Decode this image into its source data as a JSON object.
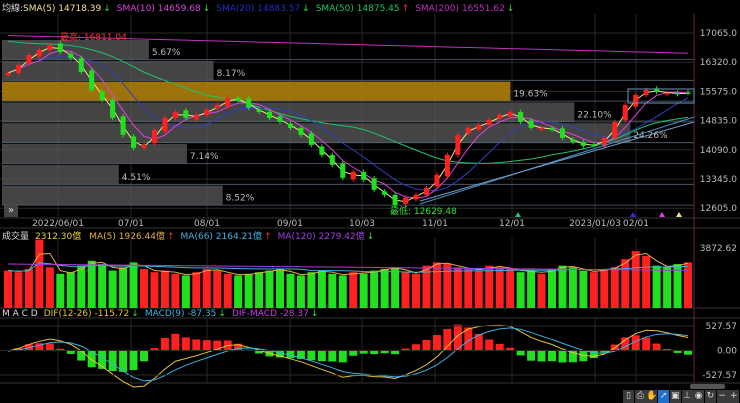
{
  "price_header": {
    "prefix": "均線:",
    "items": [
      {
        "label": "SMA(5) 14718.39",
        "arrow": "↓",
        "color": "#f0e68c"
      },
      {
        "label": "SMA(10) 14659.68",
        "arrow": "↓",
        "color": "#e040e0"
      },
      {
        "label": "SMA(20) 14883.57",
        "arrow": "↓",
        "color": "#2030c0"
      },
      {
        "label": "SMA(50) 14875.45",
        "arrow": "↑",
        "color": "#20c070"
      },
      {
        "label": "SMA(200) 16551.62",
        "arrow": "↓",
        "color": "#c030c0"
      }
    ]
  },
  "volume_header": {
    "title": "成交量",
    "items": [
      {
        "label": "2312.30億",
        "arrow": "",
        "color": "#e8d040"
      },
      {
        "label": "MA(5) 1926.44億",
        "arrow": "↑",
        "color": "#e8b040"
      },
      {
        "label": "MA(66) 2164.21億",
        "arrow": "↑",
        "color": "#40b0e0"
      },
      {
        "label": "MA(120) 2279.42億",
        "arrow": "↓",
        "color": "#a040e0"
      }
    ]
  },
  "macd_header": {
    "title": "M A C D",
    "items": [
      {
        "label": "DIF(12-26) -115.72",
        "arrow": "↓",
        "color": "#e8c040"
      },
      {
        "label": "MACD(9) -87.35",
        "arrow": "↓",
        "color": "#40b0e0"
      },
      {
        "label": "DIF-MACD -28.37",
        "arrow": "↓",
        "color": "#c040e0"
      }
    ]
  },
  "annotations": {
    "high": "最高: 16811.04",
    "low": "最低: 12629.48"
  },
  "colors": {
    "up": "#ff2020",
    "down": "#20e020",
    "profile": "#555555",
    "profile_highlight": "#b8860b",
    "background": "#000000"
  },
  "toolbar": {
    "icons": [
      "page-icon",
      "print-icon",
      "hand-icon",
      "pointer-icon",
      "info-icon",
      "chart-icon",
      "eye-icon",
      "refresh-icon",
      "zoom-out-icon",
      "zoom-in-icon"
    ],
    "expand_label": "»"
  },
  "chart_data": [
    {
      "type": "candlestick",
      "x_ticks": [
        "2022/06/01",
        "07/01",
        "08/01",
        "09/01",
        "10/03",
        "11/01",
        "12/01",
        "2023/01/03",
        "02/01"
      ],
      "y_ticks": [
        "17065.0",
        "16320.0",
        "15575.0",
        "14835.0",
        "14090.0",
        "13345.0",
        "12605.0"
      ],
      "ylim": [
        12605,
        17065
      ],
      "closes": [
        16049,
        16252,
        16506,
        16633,
        16760,
        16582,
        16430,
        16074,
        15617,
        15363,
        14906,
        14474,
        14144,
        14220,
        14601,
        14906,
        15058,
        14906,
        14982,
        15109,
        15236,
        15414,
        15363,
        15160,
        15058,
        14906,
        14804,
        14652,
        14474,
        14220,
        13966,
        13712,
        13382,
        13534,
        13331,
        13077,
        12950,
        12680,
        12874,
        12950,
        13128,
        13458,
        13966,
        14474,
        14652,
        14728,
        14855,
        14982,
        15058,
        14804,
        14652,
        14652,
        14601,
        14398,
        14296,
        14195,
        14220,
        14398,
        14804,
        15236,
        15490,
        15617,
        15566,
        15541,
        15515,
        15541
      ],
      "volume_profile": [
        {
          "pct": "5.67%",
          "value": 5.67
        },
        {
          "pct": "8.17%",
          "value": 8.17
        },
        {
          "pct": "19.63%",
          "value": 19.63,
          "highlight": true
        },
        {
          "pct": "22.10%",
          "value": 22.1
        },
        {
          "pct": "24.26%",
          "value": 24.26
        },
        {
          "pct": "7.14%",
          "value": 7.14
        },
        {
          "pct": "4.51%",
          "value": 4.51
        },
        {
          "pct": "8.52%",
          "value": 8.52
        }
      ]
    },
    {
      "type": "bar",
      "y_ticks": [
        "3872.62"
      ],
      "ylim": [
        0,
        4300
      ],
      "values": [
        2300,
        2200,
        2400,
        4200,
        2500,
        2100,
        2200,
        2600,
        2900,
        2700,
        2300,
        2500,
        2800,
        2400,
        2200,
        2300,
        2100,
        2000,
        2200,
        2400,
        2300,
        2100,
        2000,
        2100,
        2200,
        2300,
        2400,
        2100,
        2000,
        2200,
        2300,
        2100,
        2000,
        2200,
        2100,
        2300,
        2400,
        2500,
        2200,
        2100,
        2600,
        2800,
        2700,
        2500,
        2400,
        2300,
        2600,
        2500,
        2400,
        2200,
        2300,
        2100,
        2400,
        2600,
        2500,
        2300,
        2200,
        2400,
        2500,
        3000,
        3500,
        3200,
        2600,
        2500,
        2700,
        2800
      ]
    },
    {
      "type": "macd",
      "y_ticks": [
        "527.57",
        "0.00",
        "-527.57"
      ],
      "ylim": [
        -600,
        600
      ]
    }
  ]
}
